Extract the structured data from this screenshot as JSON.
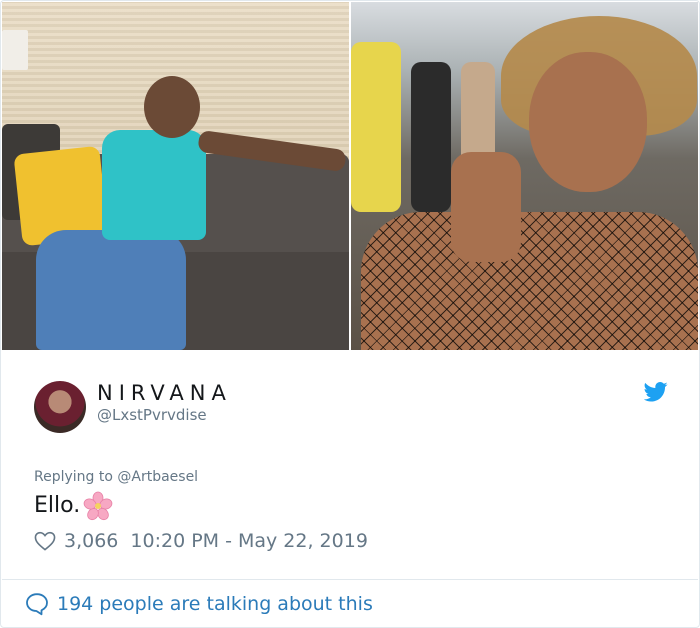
{
  "profile": {
    "display_name": "NIRVANA",
    "handle": "@LxstPvrvdise"
  },
  "tweet": {
    "reply_to": "Replying to @Artbaesel",
    "text": "Ello.",
    "like_count": "3,066",
    "timestamp": "10:20 PM - May 22, 2019"
  },
  "footer": {
    "conversation_label": "194 people are talking about this"
  },
  "icons": {
    "platform": "twitter-bird-icon",
    "emoji": "cherry-blossom-icon",
    "like": "heart-outline-icon",
    "reply": "speech-bubble-icon"
  },
  "colors": {
    "brand": "#1da1f2",
    "link": "#2b7bb9",
    "secondary_text": "#657786",
    "border": "#e1e8ed"
  }
}
